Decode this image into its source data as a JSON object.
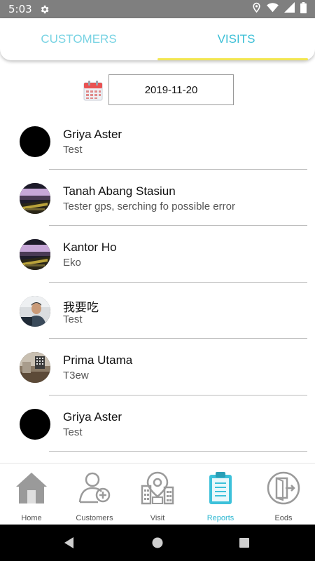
{
  "status_bar": {
    "time": "5:03"
  },
  "tabs": [
    {
      "label": "CUSTOMERS",
      "active": false
    },
    {
      "label": "VISITS",
      "active": true
    }
  ],
  "date_filter": {
    "value": "2019-11-20"
  },
  "visits": [
    {
      "name": "Griya Aster",
      "note": "Test",
      "avatar": "black-circle"
    },
    {
      "name": "Tanah Abang Stasiun",
      "note": "Tester gps, serching fo possible error",
      "avatar": "photo-desk"
    },
    {
      "name": "Kantor Ho",
      "note": "Eko",
      "avatar": "photo-desk"
    },
    {
      "name": "我要吃",
      "note": "Test",
      "avatar": "photo-person"
    },
    {
      "name": "Prima Utama",
      "note": "T3ew",
      "avatar": "photo-room"
    },
    {
      "name": "Griya Aster",
      "note": "Test",
      "avatar": "black-circle"
    }
  ],
  "bottom_nav": [
    {
      "label": "Home",
      "icon": "home-icon",
      "active": false
    },
    {
      "label": "Customers",
      "icon": "add-user-icon",
      "active": false
    },
    {
      "label": "Visit",
      "icon": "map-pin-building-icon",
      "active": false
    },
    {
      "label": "Reports",
      "icon": "clipboard-icon",
      "active": true
    },
    {
      "label": "Eods",
      "icon": "exit-door-icon",
      "active": false
    }
  ],
  "colors": {
    "accent": "#2fb8d2",
    "tab_underline": "#f2e651",
    "status_bar": "#7f7f7f",
    "icon_gray": "#9e9e9e"
  }
}
